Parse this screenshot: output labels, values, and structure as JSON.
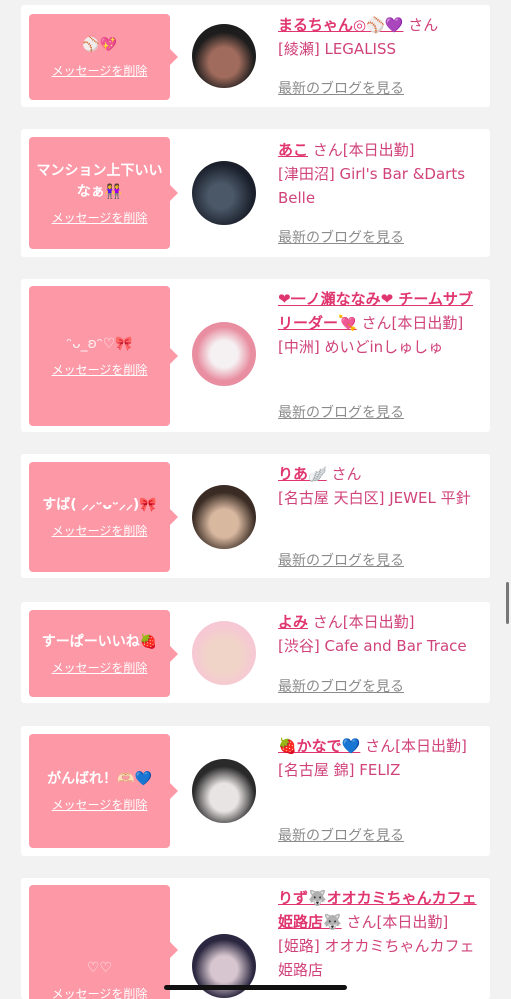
{
  "cards": [
    {
      "message": "⚾️💖",
      "delete_label": "メッセージを削除",
      "name": "まるちゃん◎⚾️💜",
      "suffix": "さん",
      "detail": "[綾瀬] LEGALISS",
      "blog_label": "最新のブログを見る",
      "avatar_colors": [
        "#1d1d1d",
        "#a06b5c"
      ]
    },
    {
      "message": "マンション上下いいなぁ👭",
      "delete_label": "メッセージを削除",
      "name": "あこ",
      "suffix": "さん[本日出勤]",
      "detail": "[津田沼] Girl's Bar &Darts Belle",
      "blog_label": "最新のブログを見る",
      "avatar_colors": [
        "#1a1f2b",
        "#4b5868"
      ]
    },
    {
      "message": "ᵔ⁠ᴗ⁠_⁠ʚ⁠ᵔ♡🎀",
      "delete_label": "メッセージを削除",
      "name": "❤一ノ瀬ななみ❤ チームサブリーダー💘",
      "suffix": "さん[本日出勤]",
      "detail": "[中洲] めいどinしゅしゅ",
      "blog_label": "最新のブログを見る",
      "avatar_colors": [
        "#e88ea0",
        "#f5f0f2"
      ]
    },
    {
      "message": "すば( ⸝⸝ᵕᴗᵕ⸝⸝)🎀",
      "delete_label": "メッセージを削除",
      "name": "りあ🪽",
      "suffix": "さん",
      "detail": "[名古屋 天白区] JEWEL 平針",
      "blog_label": "最新のブログを見る",
      "avatar_colors": [
        "#3a2c24",
        "#d9b8a0"
      ]
    },
    {
      "message": "すーぱーいいね🍓",
      "delete_label": "メッセージを削除",
      "name": "よみ",
      "suffix": "さん[本日出勤]",
      "detail": "[渋谷] Cafe and Bar Trace",
      "blog_label": "最新のブログを見る",
      "avatar_colors": [
        "#f1d4c8",
        "#f6c8d4"
      ]
    },
    {
      "message": "がんばれ！🫶🏻💙",
      "delete_label": "メッセージを削除",
      "name": "🍓かなで💙",
      "suffix": "さん[本日出勤]",
      "detail": "[名古屋 錦] FELIZ",
      "blog_label": "最新のブログを見る",
      "avatar_colors": [
        "#2a2a2a",
        "#e9e4e4"
      ]
    },
    {
      "message": "♡♡",
      "delete_label": "メッセージを削除",
      "name": "りず🐺オオカミちゃんカフェ姫路店🐺",
      "suffix": "さん[本日出勤]",
      "detail": "[姫路] オオカミちゃんカフェ 姫路店",
      "blog_label": "",
      "avatar_colors": [
        "#2b2740",
        "#d7c6cf"
      ]
    }
  ]
}
